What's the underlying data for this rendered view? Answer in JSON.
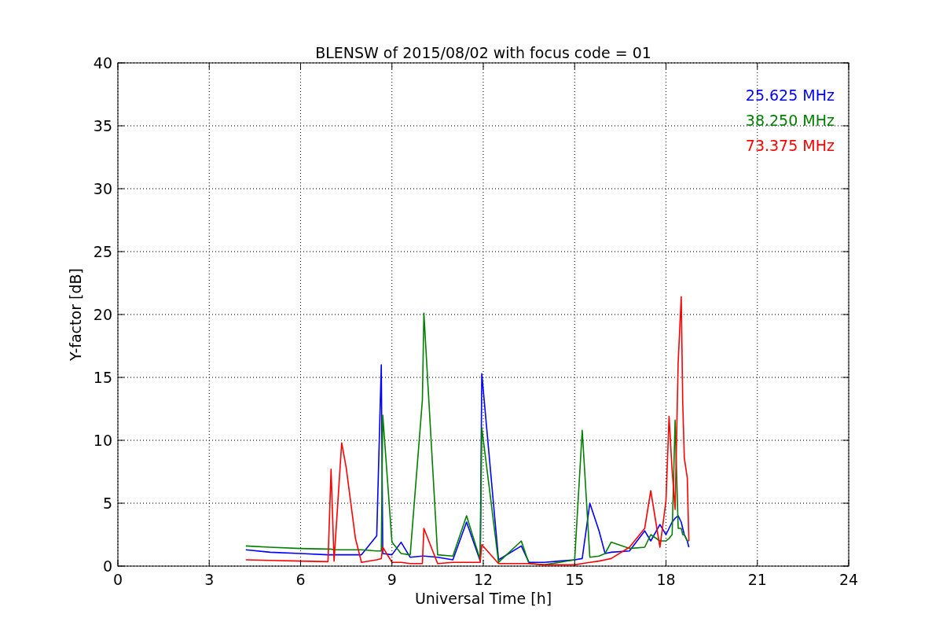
{
  "figure": {
    "chart_data": {
      "type": "line",
      "title": "BLENSW of 2015/08/02 with focus code = 01",
      "xlabel": "Universal Time [h]",
      "ylabel": "Y-factor [dB]",
      "grid": true,
      "xlim": [
        0,
        24
      ],
      "ylim": [
        0,
        40
      ],
      "xticks": [
        0,
        3,
        6,
        9,
        12,
        15,
        18,
        21,
        24
      ],
      "yticks": [
        0,
        5,
        10,
        15,
        20,
        25,
        30,
        35,
        40
      ],
      "x": [
        4.2,
        5.0,
        6.0,
        6.9,
        7.0,
        7.1,
        7.35,
        7.5,
        7.8,
        8.0,
        8.5,
        8.65,
        8.7,
        9.0,
        9.3,
        9.6,
        10.0,
        10.05,
        10.5,
        11.0,
        11.45,
        11.9,
        11.95,
        12.5,
        13.25,
        13.5,
        14.0,
        14.5,
        15.0,
        15.25,
        15.5,
        15.8,
        16.0,
        16.2,
        16.8,
        17.3,
        17.5,
        17.8,
        18.0,
        18.1,
        18.2,
        18.3,
        18.4,
        18.5,
        18.55,
        18.6,
        18.7,
        18.75
      ],
      "series": [
        {
          "name": "25.625 MHz",
          "color": "#0000ff",
          "values": [
            1.3,
            1.1,
            1.0,
            0.9,
            0.9,
            0.9,
            0.9,
            0.9,
            0.9,
            0.9,
            2.4,
            16.0,
            1.0,
            0.9,
            1.9,
            0.7,
            0.8,
            0.8,
            0.7,
            0.5,
            3.5,
            0.4,
            15.3,
            0.5,
            1.6,
            0.3,
            0.3,
            0.4,
            0.5,
            0.6,
            5.0,
            2.8,
            1.0,
            1.1,
            1.2,
            2.8,
            2.0,
            3.3,
            2.5,
            3.0,
            3.5,
            3.8,
            4.0,
            3.5,
            3.0,
            2.5,
            2.0,
            1.5
          ]
        },
        {
          "name": "38.250 MHz",
          "color": "#008000",
          "values": [
            1.6,
            1.5,
            1.4,
            1.35,
            1.35,
            1.3,
            1.3,
            1.3,
            1.3,
            1.3,
            1.2,
            1.2,
            12.0,
            1.9,
            1.0,
            0.9,
            13.2,
            20.1,
            0.9,
            0.8,
            4.0,
            0.5,
            11.0,
            0.3,
            2.0,
            0.2,
            0.1,
            0.3,
            0.5,
            10.8,
            0.7,
            0.8,
            1.0,
            1.9,
            1.4,
            1.5,
            2.5,
            2.0,
            2.0,
            2.2,
            2.5,
            11.6,
            3.0,
            3.0,
            2.5,
            2.5,
            2.0,
            2.0
          ]
        },
        {
          "name": "73.375 MHz",
          "color": "#ff0000",
          "values": [
            0.5,
            0.45,
            0.4,
            0.35,
            7.7,
            0.4,
            9.8,
            7.8,
            2.2,
            0.3,
            0.5,
            0.6,
            1.5,
            0.3,
            0.3,
            0.2,
            0.2,
            3.0,
            0.2,
            0.3,
            0.3,
            0.3,
            1.7,
            0.2,
            0.2,
            0.2,
            0.1,
            0.1,
            0.1,
            0.2,
            0.3,
            0.4,
            0.5,
            0.6,
            1.5,
            3.0,
            6.0,
            1.5,
            5.2,
            11.9,
            7.6,
            4.5,
            16.2,
            21.4,
            13.0,
            8.6,
            7.0,
            2.0
          ]
        }
      ]
    }
  }
}
